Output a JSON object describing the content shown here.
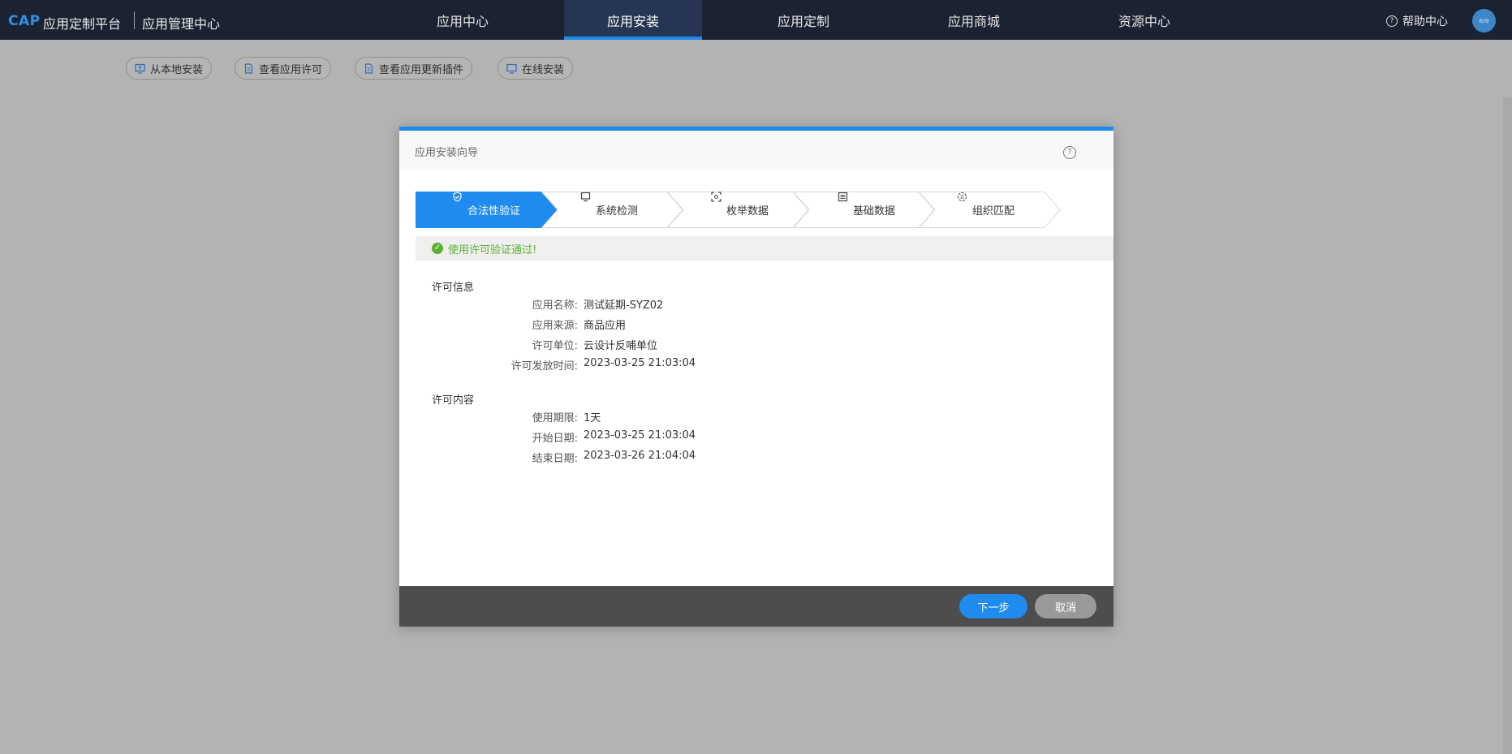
{
  "header": {
    "logo": "CAP",
    "brand": "应用定制平台",
    "subbrand": "应用管理中心",
    "nav": [
      {
        "label": "应用中心",
        "active": false
      },
      {
        "label": "应用安装",
        "active": true
      },
      {
        "label": "应用定制",
        "active": false
      },
      {
        "label": "应用商城",
        "active": false
      },
      {
        "label": "资源中心",
        "active": false
      }
    ],
    "help_label": "帮助中心",
    "avatar_text": "e/e"
  },
  "toolbar": {
    "buttons": [
      {
        "label": "从本地安装",
        "icon": "desktop-upload-icon"
      },
      {
        "label": "查看应用许可",
        "icon": "document-icon"
      },
      {
        "label": "查看应用更新插件",
        "icon": "document-icon"
      },
      {
        "label": "在线安装",
        "icon": "monitor-icon"
      }
    ]
  },
  "modal": {
    "title": "应用安装向导",
    "steps": [
      {
        "label": "合法性验证",
        "icon": "shield-check-icon",
        "active": true
      },
      {
        "label": "系统检测",
        "icon": "monitor-check-icon",
        "active": false
      },
      {
        "label": "枚举数据",
        "icon": "scan-icon",
        "active": false
      },
      {
        "label": "基础数据",
        "icon": "list-icon",
        "active": false
      },
      {
        "label": "组织匹配",
        "icon": "org-match-icon",
        "active": false
      }
    ],
    "status_message": "使用许可验证通过!",
    "license_info": {
      "title": "许可信息",
      "rows": [
        {
          "key": "应用名称:",
          "value": "测试延期-SYZ02"
        },
        {
          "key": "应用来源:",
          "value": "商品应用"
        },
        {
          "key": "许可单位:",
          "value": "云设计反哺单位"
        },
        {
          "key": "许可发放时间:",
          "value": "2023-03-25 21:03:04"
        }
      ]
    },
    "license_content": {
      "title": "许可内容",
      "rows": [
        {
          "key": "使用期限:",
          "value": "1天"
        },
        {
          "key": "开始日期:",
          "value": "2023-03-25 21:03:04"
        },
        {
          "key": "结束日期:",
          "value": "2023-03-26 21:04:04"
        }
      ]
    },
    "next_label": "下一步",
    "cancel_label": "取消"
  },
  "colors": {
    "topbar": "#1b2232",
    "accent": "#1f8bef",
    "success": "#5ab031",
    "overlay": "#b3b3b3",
    "footer": "#4d4d4d"
  }
}
